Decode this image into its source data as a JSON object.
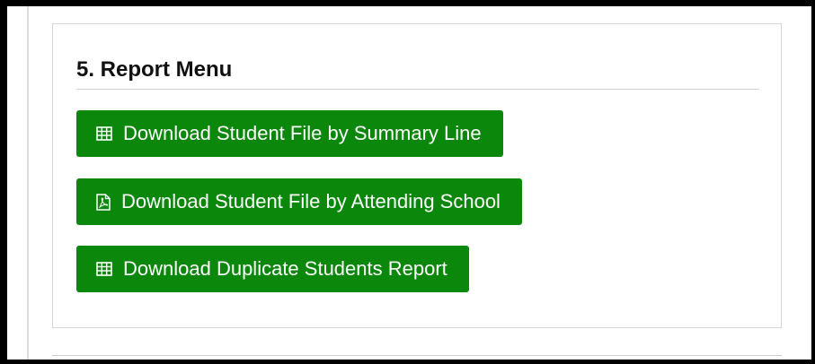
{
  "section": {
    "title": "5. Report Menu"
  },
  "buttons": [
    {
      "label": "Download Student File by Summary Line",
      "icon": "table-icon"
    },
    {
      "label": "Download Student File by Attending School",
      "icon": "pdf-icon"
    },
    {
      "label": "Download Duplicate Students Report",
      "icon": "table-icon"
    }
  ],
  "colors": {
    "button_bg": "#0b870b",
    "button_text": "#ffffff",
    "frame_border": "#000000"
  }
}
